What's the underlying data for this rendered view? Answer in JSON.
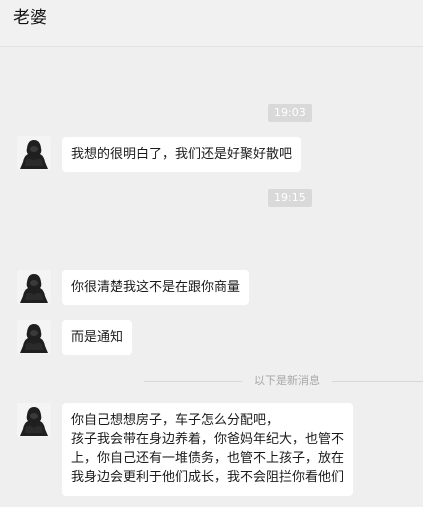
{
  "header": {
    "title": "老婆"
  },
  "timestamps": [
    "19:03",
    "19:15"
  ],
  "messages": [
    {
      "lines": [
        "我想的很明白了，我们还是好聚好散吧"
      ]
    },
    {
      "lines": [
        "你很清楚我这不是在跟你商量"
      ]
    },
    {
      "lines": [
        "而是通知"
      ]
    },
    {
      "lines": [
        "你自己想想房子，车子怎么分配吧，",
        "孩子我会带在身边养着，你爸妈年纪大，也管不",
        "上，你自己还有一堆债务，也管不上孩子，放在",
        "我身边会更利于他们成长，我不会阻拦你看他们"
      ]
    }
  ],
  "divider": {
    "label": "以下是新消息"
  },
  "contact": {
    "avatar_icon": "gorilla-avatar-icon"
  }
}
